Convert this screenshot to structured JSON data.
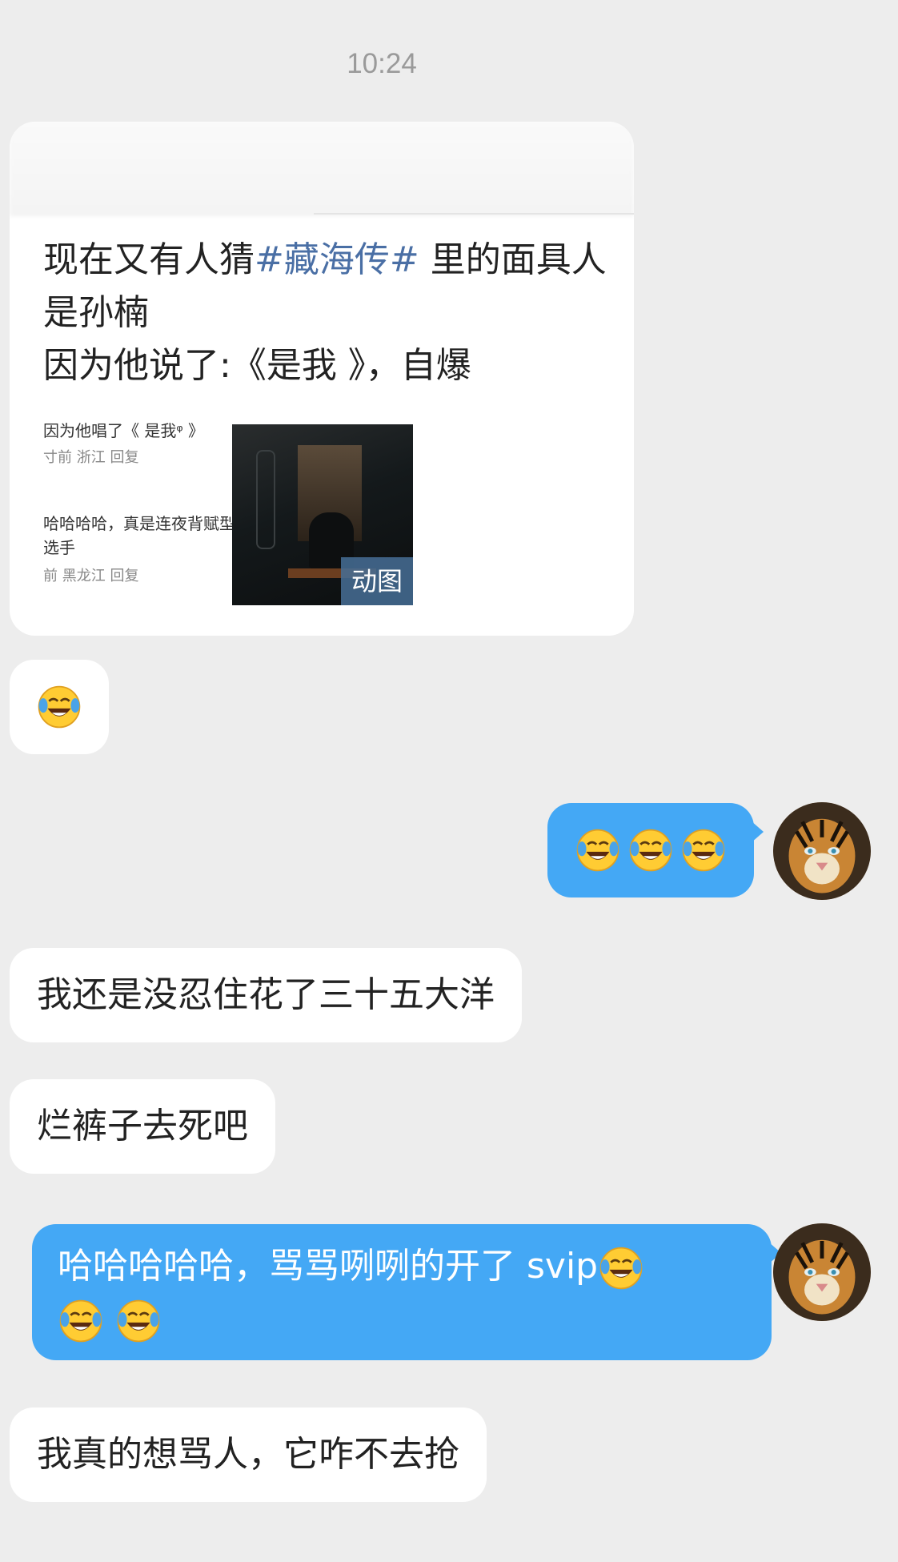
{
  "timestamp": "10:24",
  "quoted_card": {
    "text_prefix": "现在又有人猜",
    "hashtag": "#藏海传#",
    "text_rest": " 里的面具人",
    "line2": "是孙楠",
    "line3": "因为他说了:《是我 》，自爆",
    "comment1": "因为他唱了《 是我ᵠ 》",
    "comment1_meta": "寸前 浙江  回复",
    "comment2": "哈哈哈哈，真是连夜背赋型选手",
    "comment2_meta": "前 黑龙江  回复",
    "media_label": "动图"
  },
  "messages": [
    {
      "side": "in",
      "text": "",
      "emoji_count": 1
    },
    {
      "side": "out",
      "text": "",
      "emoji_count": 3
    },
    {
      "side": "in",
      "text": "我还是没忍住花了三十五大洋"
    },
    {
      "side": "in",
      "text": "烂裤子去死吧"
    },
    {
      "side": "out",
      "text": "哈哈哈哈哈，骂骂咧咧的开了 svip",
      "emoji_count": 3
    },
    {
      "side": "in",
      "text": "我真的想骂人，它咋不去抢"
    }
  ],
  "emoji_name": "laughing-crying-face-icon",
  "colors": {
    "background": "#ededed",
    "incoming_bubble": "#ffffff",
    "outgoing_bubble": "#44a8f5",
    "hashtag": "#4a6fa5"
  }
}
